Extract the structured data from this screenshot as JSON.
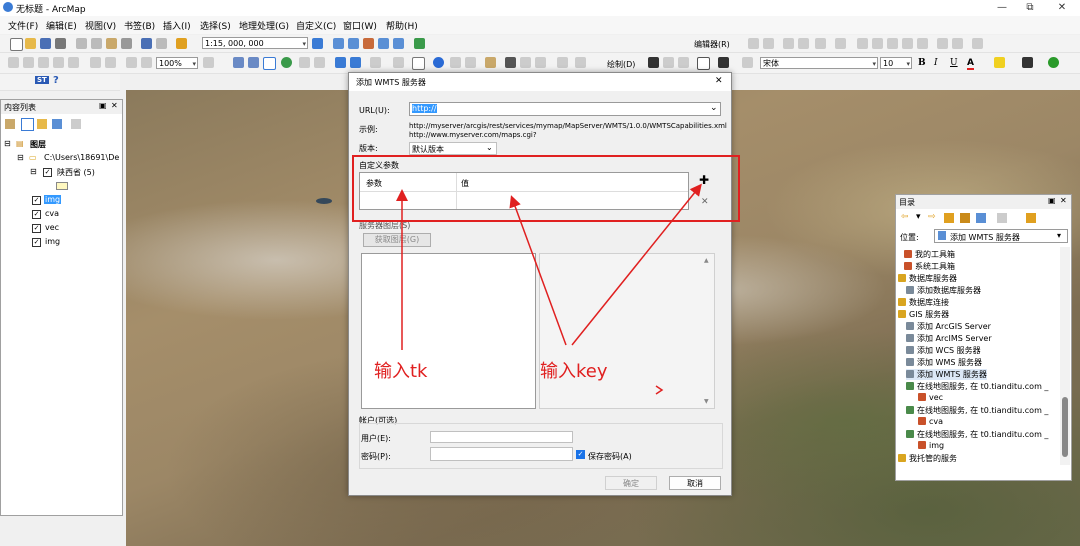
{
  "window": {
    "title": "无标题 - ArcMap",
    "minimize": "—",
    "restore": "⧉",
    "close": "✕"
  },
  "menu": [
    "文件(F)",
    "编辑(E)",
    "视图(V)",
    "书签(B)",
    "插入(I)",
    "选择(S)",
    "地理处理(G)",
    "自定义(C)",
    "窗口(W)",
    "帮助(H)"
  ],
  "toolbar": {
    "scale": "1:15, 000, 000",
    "zoom_percent": "100%",
    "editor_label": "编辑器(R)",
    "draw_label": "绘制(D)",
    "font_name": "宋体",
    "font_size": "10",
    "bold": "B",
    "italic": "I",
    "underline": "U",
    "font_color": "A",
    "st_label": "ST",
    "help": "?"
  },
  "toc": {
    "title": "内容列表",
    "root": "图层",
    "path": "C:\\Users\\18691\\De",
    "layer_group": "陕西省 (5)",
    "layers": [
      "img",
      "cva",
      "vec",
      "img"
    ]
  },
  "dialog": {
    "title": "添加 WMTS 服务器",
    "url_label": "URL(U):",
    "url_value": "http://",
    "example_label": "示例:",
    "example_line1": "http://myserver/arcgis/rest/services/mymap/MapServer/WMTS/1.0.0/WMTSCapabilities.xml",
    "example_line2": "http://www.myserver.com/maps.cgi?",
    "version_label": "版本:",
    "version_value": "默认版本",
    "custom_params_label": "自定义参数",
    "col_param": "参数",
    "col_value": "值",
    "add_glyph": "✚",
    "remove_glyph": "✕",
    "service_layers_label": "服务器图层(S)",
    "get_layers_button": "获取图层(G)",
    "account_label": "帐户(可选)",
    "user_label": "用户(E):",
    "password_label": "密码(P):",
    "save_password_label": "保存密码(A)",
    "ok_button": "确定",
    "cancel_button": "取消"
  },
  "annotations": {
    "tk": "输入tk",
    "key": "输入key"
  },
  "catalog": {
    "title": "目录",
    "location_label": "位置:",
    "location_value": "添加 WMTS 服务器",
    "items": [
      {
        "label": "我的工具箱",
        "indent": 1
      },
      {
        "label": "系统工具箱",
        "indent": 1
      },
      {
        "label": "数据库服务器",
        "indent": 0
      },
      {
        "label": "添加数据库服务器",
        "indent": 1
      },
      {
        "label": "数据库连接",
        "indent": 0
      },
      {
        "label": "GIS 服务器",
        "indent": 0
      },
      {
        "label": "添加 ArcGIS Server",
        "indent": 1
      },
      {
        "label": "添加 ArcIMS Server",
        "indent": 1
      },
      {
        "label": "添加 WCS 服务器",
        "indent": 1
      },
      {
        "label": "添加 WMS 服务器",
        "indent": 1
      },
      {
        "label": "添加 WMTS 服务器",
        "indent": 1
      },
      {
        "label": "在线地图服务, 在 t0.tianditu.com _",
        "indent": 1
      },
      {
        "label": "vec",
        "indent": 2
      },
      {
        "label": "在线地图服务, 在 t0.tianditu.com _",
        "indent": 1
      },
      {
        "label": "cva",
        "indent": 2
      },
      {
        "label": "在线地图服务, 在 t0.tianditu.com _",
        "indent": 1
      },
      {
        "label": "img",
        "indent": 2
      },
      {
        "label": "我托管的服务",
        "indent": 0
      }
    ]
  },
  "colors": {
    "annotation_red": "#e02020",
    "selection_blue": "#3399ff"
  }
}
